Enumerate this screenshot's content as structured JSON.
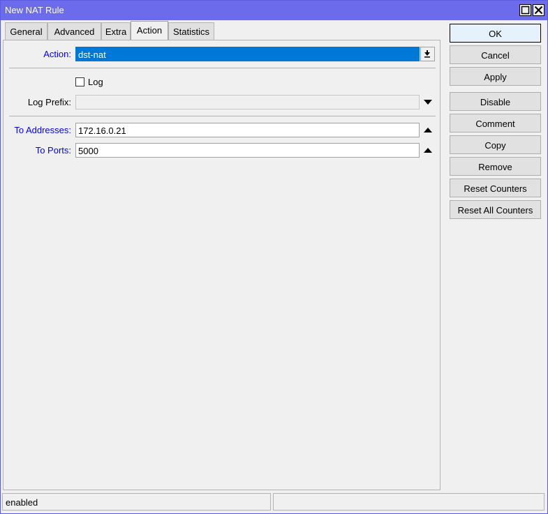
{
  "window": {
    "title": "New NAT Rule"
  },
  "tabs": [
    {
      "label": "General",
      "active": false
    },
    {
      "label": "Advanced",
      "active": false
    },
    {
      "label": "Extra",
      "active": false
    },
    {
      "label": "Action",
      "active": true
    },
    {
      "label": "Statistics",
      "active": false
    }
  ],
  "form": {
    "action": {
      "label": "Action:",
      "value": "dst-nat"
    },
    "log": {
      "label": "Log",
      "checked": false
    },
    "log_prefix": {
      "label": "Log Prefix:",
      "value": ""
    },
    "to_addresses": {
      "label": "To Addresses:",
      "value": "172.16.0.21"
    },
    "to_ports": {
      "label": "To Ports:",
      "value": "5000"
    }
  },
  "buttons": {
    "ok": "OK",
    "cancel": "Cancel",
    "apply": "Apply",
    "disable": "Disable",
    "comment": "Comment",
    "copy": "Copy",
    "remove": "Remove",
    "reset_counters": "Reset Counters",
    "reset_all_counters": "Reset All Counters"
  },
  "status": {
    "left": "enabled",
    "right": ""
  },
  "icons": {
    "maximize": "maximize-icon",
    "close": "close-icon",
    "dropdown": "triangle-down-icon",
    "spinner_up": "triangle-up-icon"
  },
  "colors": {
    "titlebar": "#6b6bec",
    "selection": "#0078d7",
    "label_blue": "#0000ff"
  }
}
